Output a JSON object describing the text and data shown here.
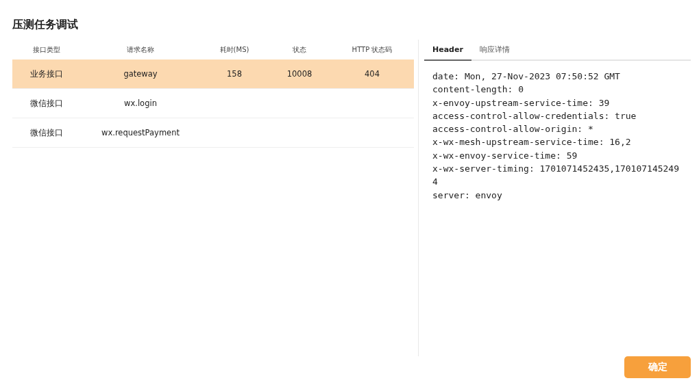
{
  "title": "压测任务调试",
  "table": {
    "columns": [
      "接口类型",
      "请求名称",
      "耗时(MS)",
      "状态",
      "HTTP 状态码"
    ],
    "rows": [
      {
        "cells": [
          "业务接口",
          "gateway",
          "158",
          "10008",
          "404"
        ],
        "selected": true
      },
      {
        "cells": [
          "微信接口",
          "wx.login",
          "",
          "",
          ""
        ],
        "selected": false
      },
      {
        "cells": [
          "微信接口",
          "wx.requestPayment",
          "",
          "",
          ""
        ],
        "selected": false
      }
    ]
  },
  "tabs": [
    {
      "label": "Header",
      "selected": true
    },
    {
      "label": "响应详情",
      "selected": false
    }
  ],
  "header_lines": [
    "date: Mon, 27-Nov-2023 07:50:52 GMT",
    "content-length: 0",
    "x-envoy-upstream-service-time: 39",
    "access-control-allow-credentials: true",
    "access-control-allow-origin: *",
    "x-wx-mesh-upstream-service-time: 16,2",
    "x-wx-envoy-service-time: 59",
    "x-wx-server-timing: 1701071452435,1701071452494",
    "server: envoy"
  ],
  "confirm_button": "确定"
}
